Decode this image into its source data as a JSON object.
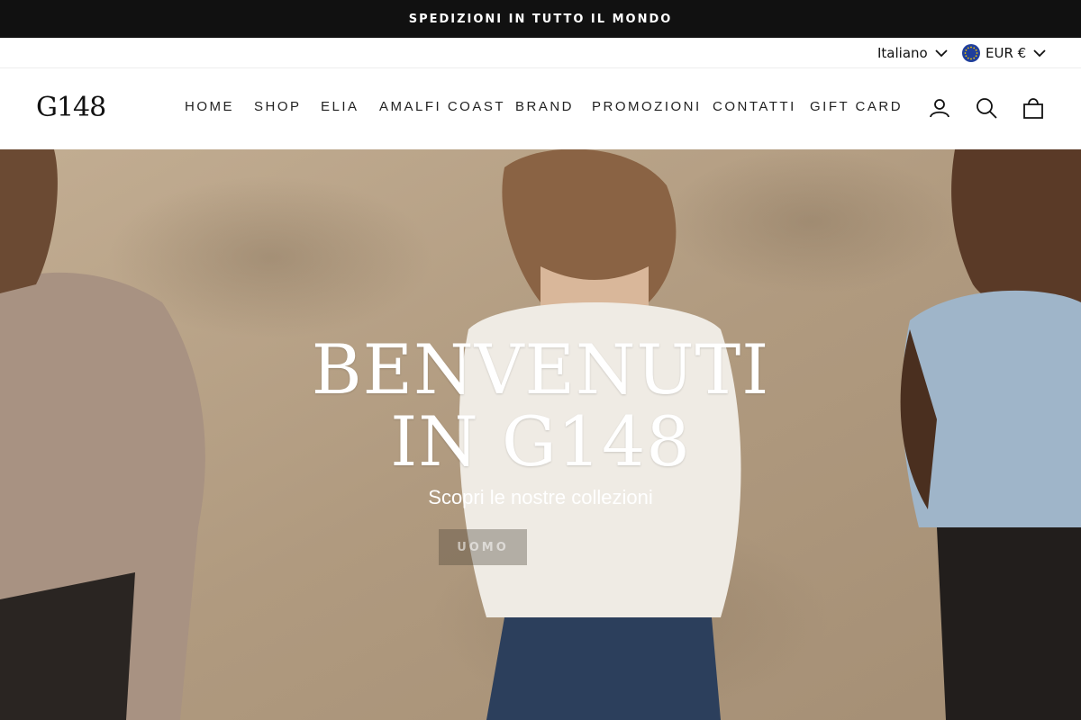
{
  "announcement": {
    "text": "SPEDIZIONI IN TUTTO IL MONDO"
  },
  "utility": {
    "language": "Italiano",
    "currency": "EUR €"
  },
  "header": {
    "logo": "G148",
    "nav": [
      {
        "label": "HOME"
      },
      {
        "label": "SHOP"
      },
      {
        "label": "ELIA"
      },
      {
        "label": "AMALFI COAST"
      },
      {
        "label": "BRAND"
      },
      {
        "label": "PROMOZIONI"
      },
      {
        "label": "CONTATTI"
      },
      {
        "label": "GIFT CARD"
      }
    ],
    "icons": [
      "user-icon",
      "search-icon",
      "cart-icon"
    ]
  },
  "hero": {
    "title_line1": "BENVENUTI",
    "title_line2": "IN G148",
    "subtitle": "Scopri le nostre collezioni",
    "button": "UOMO"
  },
  "colors": {
    "announcement_bg": "#111111",
    "hero_wall": "#b9a48a",
    "flag_blue": "#1f3f9c",
    "flag_star": "#f2c400"
  }
}
